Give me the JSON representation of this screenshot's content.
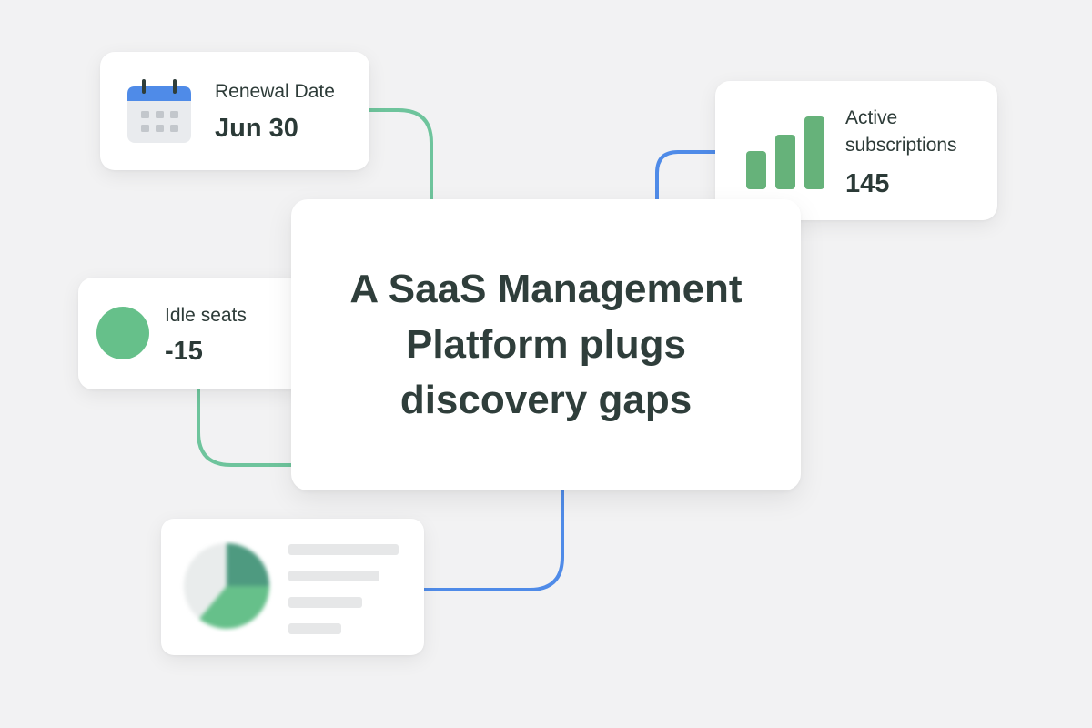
{
  "headline": {
    "title": "A SaaS Management Platform plugs discovery gaps"
  },
  "renewal_card": {
    "icon": "calendar-icon",
    "label": "Renewal Date",
    "value": "Jun 30"
  },
  "active_card": {
    "icon": "bar-chart-icon",
    "label": "Active subscriptions",
    "value": "145"
  },
  "idle_card": {
    "icon": "status-dot-icon",
    "label": "Idle seats",
    "value": "-15"
  },
  "pie_card": {
    "icon": "pie-chart-icon"
  },
  "colors": {
    "background": "#f2f2f3",
    "green": "#66c08a",
    "dark_green": "#4e9a80",
    "blue": "#4f8be8",
    "connector_green": "#6ec49c",
    "text": "#2b3a37"
  }
}
